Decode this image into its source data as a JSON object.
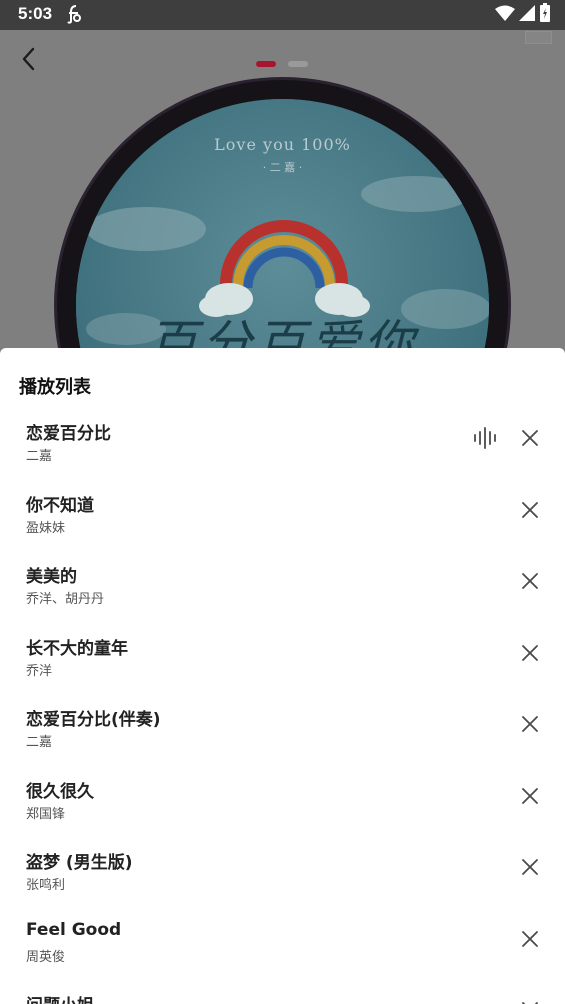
{
  "status_bar": {
    "time": "5:03",
    "icons": [
      "app-notification-icon",
      "wifi-icon",
      "signal-icon",
      "battery-charging-icon"
    ]
  },
  "player": {
    "back_icon": "chevron-left-icon",
    "pager": {
      "pages": 2,
      "active_page": 1
    },
    "cover": {
      "text_top": "Love you 100%",
      "text_artist": "· 二 嘉 ·",
      "text_main": "百分百爱你"
    }
  },
  "playlist": {
    "title": "播放列表",
    "songs": [
      {
        "title": "恋爱百分比",
        "artist": "二嘉",
        "playing": true
      },
      {
        "title": "你不知道",
        "artist": "盈妹妹",
        "playing": false
      },
      {
        "title": "美美的",
        "artist": "乔洋、胡丹丹",
        "playing": false
      },
      {
        "title": "长不大的童年",
        "artist": "乔洋",
        "playing": false
      },
      {
        "title": "恋爱百分比(伴奏)",
        "artist": "二嘉",
        "playing": false
      },
      {
        "title": "很久很久",
        "artist": "郑国锋",
        "playing": false
      },
      {
        "title": "盗梦 (男生版)",
        "artist": "张鸣利",
        "playing": false
      },
      {
        "title": "Feel Good",
        "artist": "周英俊",
        "playing": false
      },
      {
        "title": "问题小姐",
        "artist": "",
        "playing": false
      }
    ]
  },
  "colors": {
    "accent": "#a8142f",
    "sheet_bg": "#ffffff",
    "overlay": "#7f7f7f"
  }
}
